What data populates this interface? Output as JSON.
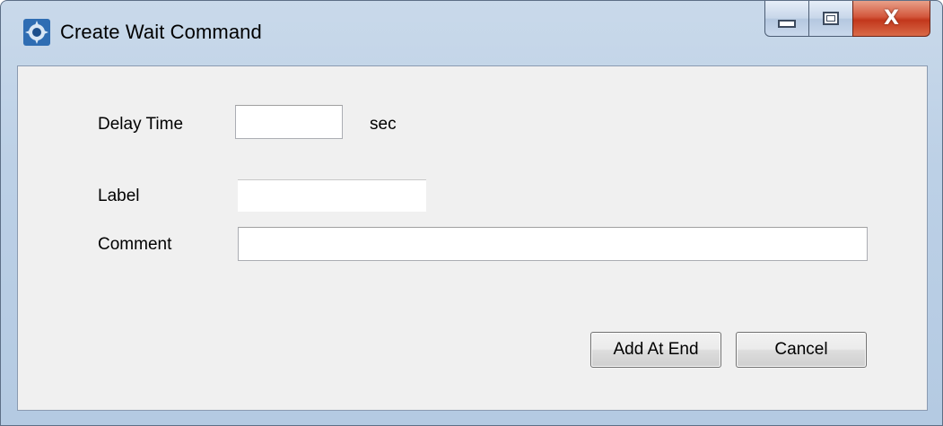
{
  "window": {
    "title": "Create Wait Command",
    "icon": "gear-app-icon",
    "controls": {
      "minimize": "minimize-icon",
      "maximize": "maximize-icon",
      "close": "close-icon",
      "close_glyph": "X"
    }
  },
  "form": {
    "delay_time": {
      "label": "Delay Time",
      "value": "",
      "unit": "sec"
    },
    "label_field": {
      "label": "Label",
      "value": ""
    },
    "comment_field": {
      "label": "Comment",
      "value": ""
    }
  },
  "buttons": {
    "add_at_end": "Add At End",
    "cancel": "Cancel"
  },
  "colors": {
    "title_frame": "#bcd0e6",
    "client_bg": "#f0f0f0",
    "close_button": "#c2371c"
  }
}
